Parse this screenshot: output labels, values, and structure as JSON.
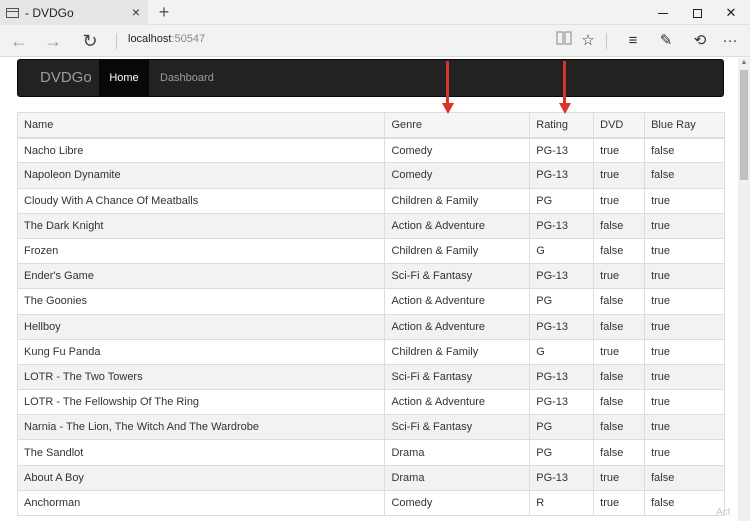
{
  "window": {
    "tab_title": "- DVDGo",
    "tab_close": "×",
    "new_tab": "+",
    "close_glyph": "✕"
  },
  "toolbar": {
    "back_icon": "←",
    "forward_icon": "→",
    "refresh_icon": "↻",
    "address_host": "localhost",
    "address_port": ":50547",
    "reading_icon": "📖",
    "favorite_icon": "☆",
    "hub_icon": "≡",
    "note_icon": "✎",
    "share_icon": "⟲",
    "more_icon": "···"
  },
  "navbar": {
    "brand": "DVDGo",
    "items": [
      {
        "label": "Home",
        "active": true
      },
      {
        "label": "Dashboard",
        "active": false
      }
    ]
  },
  "table": {
    "columns": [
      "Name",
      "Genre",
      "Rating",
      "DVD",
      "Blue Ray"
    ],
    "rows": [
      [
        "Nacho Libre",
        "Comedy",
        "PG-13",
        "true",
        "false"
      ],
      [
        "Napoleon Dynamite",
        "Comedy",
        "PG-13",
        "true",
        "false"
      ],
      [
        "Cloudy With A Chance Of Meatballs",
        "Children & Family",
        "PG",
        "true",
        "true"
      ],
      [
        "The Dark Knight",
        "Action & Adventure",
        "PG-13",
        "false",
        "true"
      ],
      [
        "Frozen",
        "Children & Family",
        "G",
        "false",
        "true"
      ],
      [
        "Ender's Game",
        "Sci-Fi & Fantasy",
        "PG-13",
        "true",
        "true"
      ],
      [
        "The Goonies",
        "Action & Adventure",
        "PG",
        "false",
        "true"
      ],
      [
        "Hellboy",
        "Action & Adventure",
        "PG-13",
        "false",
        "true"
      ],
      [
        "Kung Fu Panda",
        "Children & Family",
        "G",
        "true",
        "true"
      ],
      [
        "LOTR - The Two Towers",
        "Sci-Fi & Fantasy",
        "PG-13",
        "false",
        "true"
      ],
      [
        "LOTR - The Fellowship Of The Ring",
        "Action & Adventure",
        "PG-13",
        "false",
        "true"
      ],
      [
        "Narnia - The Lion, The Witch And The Wardrobe",
        "Sci-Fi & Fantasy",
        "PG",
        "false",
        "true"
      ],
      [
        "The Sandlot",
        "Drama",
        "PG",
        "false",
        "true"
      ],
      [
        "About A Boy",
        "Drama",
        "PG-13",
        "true",
        "false"
      ],
      [
        "Anchorman",
        "Comedy",
        "R",
        "true",
        "false"
      ]
    ]
  },
  "watermark": "Act",
  "colors": {
    "navbar_bg": "#222222",
    "active_nav_bg": "#080808",
    "annotation_arrow": "#d9342b"
  }
}
